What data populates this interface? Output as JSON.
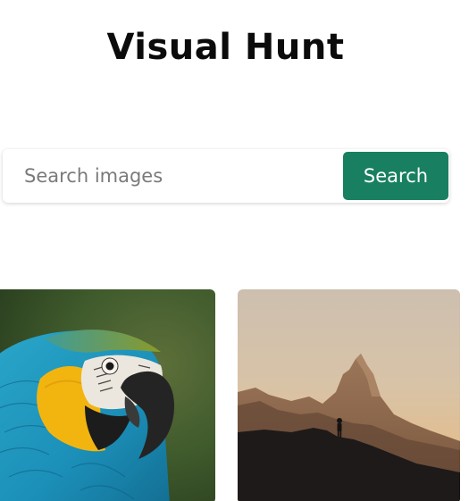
{
  "app": {
    "title": "Visual Hunt"
  },
  "search": {
    "placeholder": "Search images",
    "value": "",
    "button_label": "Search"
  },
  "colors": {
    "accent": "#188060",
    "title": "#0b0b0b",
    "placeholder": "#7a7a7a"
  },
  "gallery": {
    "images": [
      {
        "subject": "macaw-parrot"
      },
      {
        "subject": "mountain-silhouette"
      }
    ]
  }
}
